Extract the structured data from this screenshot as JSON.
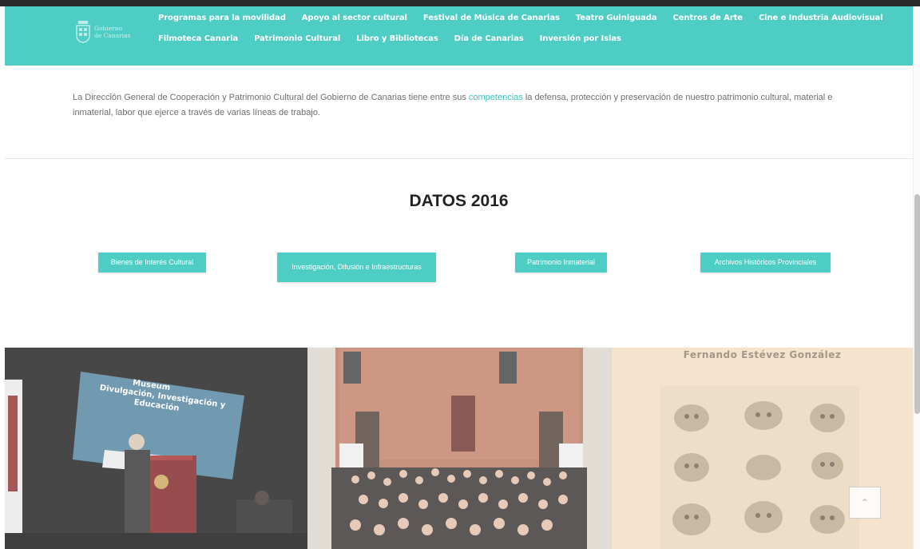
{
  "logo": {
    "line1": "Gobierno",
    "line2": "de Canarias"
  },
  "nav": {
    "row1": [
      "Programas para la movilidad",
      "Apoyo al sector cultural",
      "Festival de Música de Canarias",
      "Teatro Guiniguada",
      "Centros de Arte",
      "Cine e Industria Audiovisual"
    ],
    "row2": [
      "Filmoteca Canaria",
      "Patrimonio Cultural",
      "Libro y Bibliotecas",
      "Día de Canarias",
      "Inversión por Islas"
    ]
  },
  "intro": {
    "before": "La Dirección General de Cooperación y Patrimonio Cultural del Gobierno de Canarias tiene entre sus ",
    "link": "competencias",
    "after": " la defensa, protección y preservación de nuestro patrimonio cultural, material e inmaterial, labor que ejerce a través de varias líneas de trabajo."
  },
  "section": {
    "title": "DATOS 2016"
  },
  "buttons": [
    "Bienes de Interés Cultural",
    "Investigación, Difusión e Infraestructuras",
    "Patrimonio Inmaterial",
    "Archivos Históricos Provinciales"
  ],
  "gallery": {
    "p1_screen": [
      "Museum",
      "Divulgación, Investigación y",
      "Educación"
    ],
    "p3_title": "Fernando Estévez González"
  },
  "colors": {
    "accent": "#4ecdc4",
    "link": "#3bbfb6",
    "text": "#6f6f6f",
    "title": "#222222"
  },
  "icons": {
    "logo": "canarias-crest-icon",
    "back_to_top": "chevron-up-icon"
  }
}
